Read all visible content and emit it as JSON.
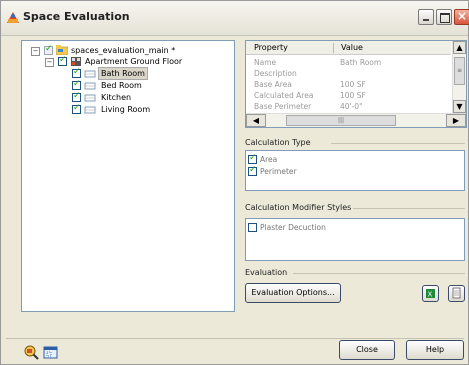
{
  "window": {
    "title": "Space Evaluation"
  },
  "tree": {
    "root": {
      "label": "spaces_evaluation_main *"
    },
    "group": {
      "label": "Apartment Ground Floor"
    },
    "rooms": [
      {
        "label": "Bath Room",
        "selected": true
      },
      {
        "label": "Bed Room",
        "selected": false
      },
      {
        "label": "Kitchen",
        "selected": false
      },
      {
        "label": "Living Room",
        "selected": false
      }
    ]
  },
  "property_grid": {
    "headers": [
      "Property",
      "Value"
    ],
    "rows": [
      {
        "key": "Name",
        "value": "Bath Room"
      },
      {
        "key": "Description",
        "value": ""
      },
      {
        "key": "Base Area",
        "value": "100  SF"
      },
      {
        "key": "Calculated Area",
        "value": "100  SF"
      },
      {
        "key": "Base Perimeter",
        "value": "40'-0\""
      }
    ]
  },
  "calculation_type": {
    "label": "Calculation Type",
    "options": [
      {
        "label": "Area",
        "checked": true
      },
      {
        "label": "Perimeter",
        "checked": true
      }
    ]
  },
  "modifier_styles": {
    "label": "Calculation Modifier Styles",
    "options": [
      {
        "label": "Plaster Decuction",
        "checked": false
      }
    ]
  },
  "evaluation": {
    "label": "Evaluation",
    "options_button": "Evaluation Options..."
  },
  "footer": {
    "close_button": "Close",
    "help_button": "Help"
  },
  "icons": {
    "app": "space-evaluation-icon",
    "export_excel": "excel-export-icon",
    "export_text": "text-export-icon",
    "zoom": "zoom-to-space-icon",
    "window_select": "select-window-icon"
  }
}
